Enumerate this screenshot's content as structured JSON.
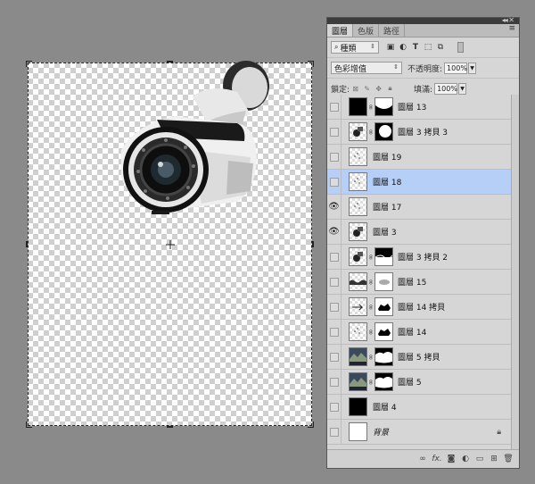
{
  "panel": {
    "tabs": [
      "圖層",
      "色版",
      "路徑"
    ],
    "filter_kind": "種類",
    "blend_mode": "色彩增值",
    "opacity_label": "不透明度:",
    "opacity_value": "100%",
    "lock_label": "鎖定:",
    "fill_label": "填滿:",
    "fill_value": "100%"
  },
  "layers": [
    {
      "name": "圖層 13",
      "visible": false,
      "thumb": "black",
      "mask": "white-top",
      "selected": false
    },
    {
      "name": "圖層 3 拷貝 3",
      "visible": false,
      "thumb": "cam",
      "mask": "blob",
      "selected": false
    },
    {
      "name": "圖層 19",
      "visible": false,
      "thumb": "dots",
      "mask": null,
      "selected": false
    },
    {
      "name": "圖層 18",
      "visible": false,
      "thumb": "dots",
      "mask": null,
      "selected": true
    },
    {
      "name": "圖層 17",
      "visible": true,
      "thumb": "dots",
      "mask": null,
      "selected": false
    },
    {
      "name": "圖層 3",
      "visible": true,
      "thumb": "cam",
      "mask": null,
      "selected": false
    },
    {
      "name": "圖層 3 拷貝 2",
      "visible": false,
      "thumb": "cam",
      "mask": "white-bottom",
      "selected": false
    },
    {
      "name": "圖層 15",
      "visible": false,
      "thumb": "wave",
      "mask": "feather",
      "selected": false
    },
    {
      "name": "圖層 14 拷貝",
      "visible": false,
      "thumb": "arrow",
      "mask": "shape",
      "selected": false
    },
    {
      "name": "圖層 14",
      "visible": false,
      "thumb": "dots",
      "mask": "shape",
      "selected": false
    },
    {
      "name": "圖層 5 拷貝",
      "visible": false,
      "thumb": "scene",
      "mask": "cloud",
      "selected": false
    },
    {
      "name": "圖層 5",
      "visible": false,
      "thumb": "scene",
      "mask": "cloud",
      "selected": false
    },
    {
      "name": "圖層 4",
      "visible": false,
      "thumb": "black",
      "mask": null,
      "selected": false
    },
    {
      "name": "背景",
      "visible": false,
      "thumb": "white",
      "mask": null,
      "selected": false,
      "locked": true
    }
  ]
}
